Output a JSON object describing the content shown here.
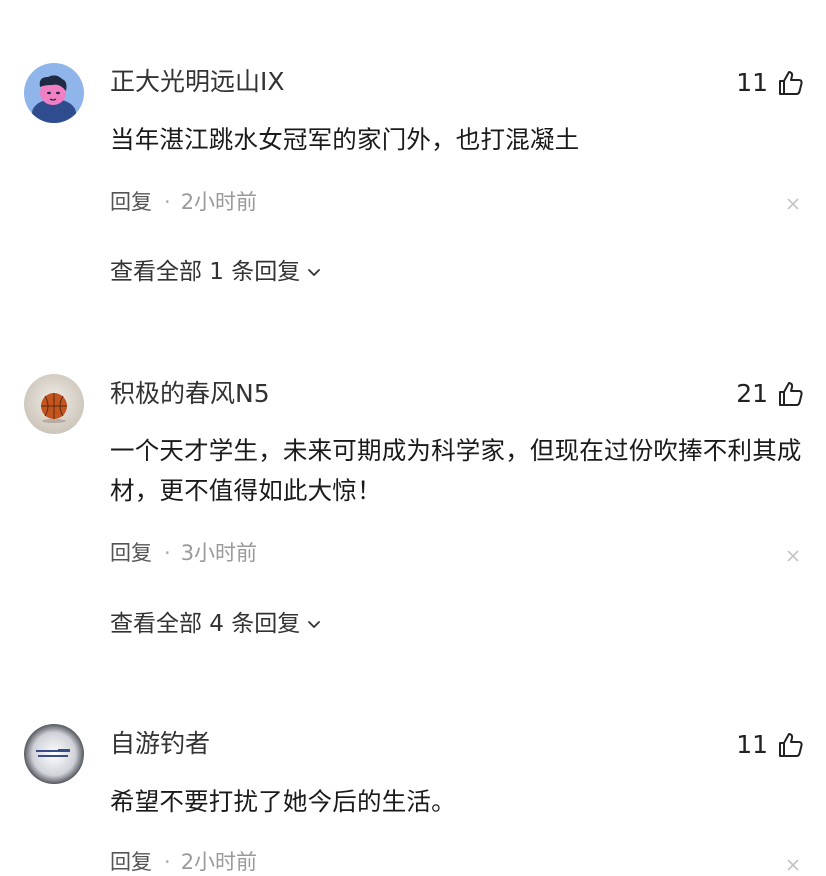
{
  "comments": [
    {
      "username": "正大光明远山IX",
      "likes": "11",
      "text": "当年湛江跳水女冠军的家门外，也打混凝土",
      "reply_label": "回复",
      "separator": "·",
      "time": "2小时前",
      "view_replies": "查看全部 1 条回复"
    },
    {
      "username": "积极的春风N5",
      "likes": "21",
      "text": "一个天才学生，未来可期成为科学家，但现在过份吹捧不利其成材，更不值得如此大惊！",
      "reply_label": "回复",
      "separator": "·",
      "time": "3小时前",
      "view_replies": "查看全部 4 条回复"
    },
    {
      "username": "自游钓者",
      "likes": "11",
      "text": "希望不要打扰了她今后的生活。",
      "reply_label": "回复",
      "separator": "·",
      "time": "2小时前"
    }
  ],
  "icons": {
    "like": "thumbs-up-icon",
    "dismiss": "close-icon",
    "expand": "chevron-down-icon"
  }
}
